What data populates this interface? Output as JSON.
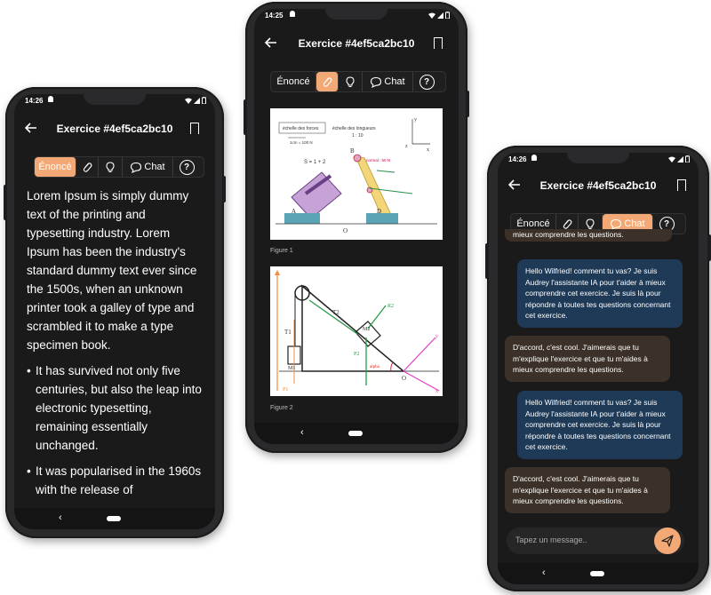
{
  "common": {
    "title": "Exercice #4ef5ca2bc10",
    "tabs": {
      "enonce": "Énoncé",
      "chat": "Chat",
      "help": "?"
    }
  },
  "phone1": {
    "time": "14:26",
    "paragraph": "Lorem Ipsum is simply dummy text of the printing and typesetting industry. Lorem Ipsum has been the industry's standard dummy text ever since the 1500s, when an unknown printer took a galley of type and scrambled it to make a type specimen book.",
    "bullets": [
      "It has survived not only five centuries, but also the leap into electronic typesetting, remaining essentially unchanged.",
      "It was popularised in the 1960s with the release of"
    ]
  },
  "phone2": {
    "time": "14:25",
    "figures": [
      {
        "caption": "Figure 1",
        "labels": {
          "speed_scale": "échelle des forces",
          "length_scale": "échelle des longueurs",
          "speed_unit": "1cm = 100 N",
          "length_ratio": "1 : 10",
          "s_label": "S = 1 + 2",
          "normal": "normal : 50 N",
          "a": "A",
          "b": "B",
          "d": "D",
          "o": "O",
          "x": "x",
          "y": "y",
          "z": "z"
        }
      },
      {
        "caption": "Figure 2",
        "labels": {
          "t1": "T1",
          "t2": "T2",
          "m1": "M1",
          "m2": "M2",
          "p1": "P1",
          "p2": "P2",
          "r2": "R2",
          "alpha": "alpha",
          "o": "O",
          "x": "x",
          "y": "y"
        }
      }
    ]
  },
  "phone3": {
    "time": "14:26",
    "top_partial": "mieux comprendre les questions.",
    "messages": [
      {
        "role": "ai",
        "text": "Hello Wilfried! comment tu vas? Je suis Audrey l'assistante IA pour t'aider à mieux comprendre cet exercice. Je suis là pour répondre à toutes tes questions concernant cet exercice."
      },
      {
        "role": "user",
        "text": "D'accord, c'est cool. J'aimerais que tu m'explique l'exercice et que tu m'aides à mieux comprendre les questions."
      },
      {
        "role": "ai",
        "text": "Hello Wilfried! comment tu vas? Je suis Audrey l'assistante IA pour t'aider à mieux comprendre cet exercice. Je suis là pour répondre à toutes tes questions concernant cet exercice."
      },
      {
        "role": "user",
        "text": "D'accord, c'est cool. J'aimerais que tu m'explique l'exercice et que tu m'aides à mieux comprendre les questions."
      }
    ],
    "input_placeholder": "Tapez un message.."
  },
  "colors": {
    "accent": "#f2a975",
    "ai_bubble": "#1e3a57",
    "user_bubble": "#3b3128",
    "screen_bg": "#1a1a1a"
  },
  "icons": [
    "back-arrow-icon",
    "bookmark-icon",
    "paperclip-icon",
    "lightbulb-icon",
    "chat-bubble-icon",
    "help-icon",
    "send-icon"
  ]
}
